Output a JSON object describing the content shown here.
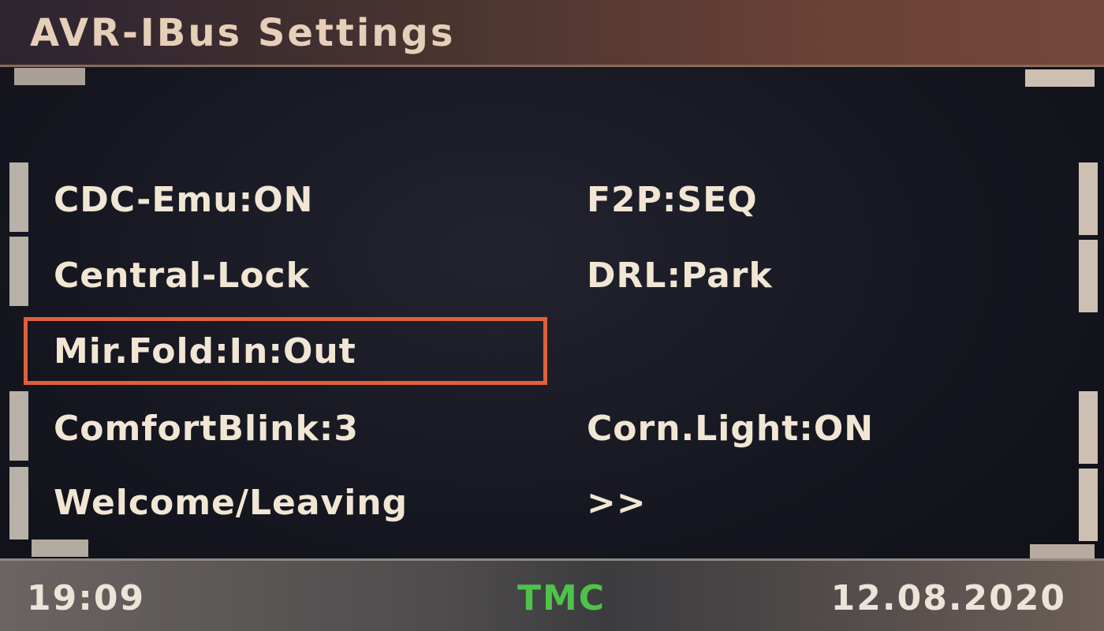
{
  "header": {
    "title": "AVR-IBus Settings"
  },
  "menu": {
    "left": [
      {
        "label": "CDC-Emu:ON"
      },
      {
        "label": "Central-Lock"
      },
      {
        "label": "Mir.Fold:In:Out"
      },
      {
        "label": "ComfortBlink:3"
      },
      {
        "label": "Welcome/Leaving"
      }
    ],
    "right": [
      {
        "label": "F2P:SEQ"
      },
      {
        "label": "DRL:Park"
      },
      {
        "label": ""
      },
      {
        "label": "Corn.Light:ON"
      },
      {
        "label": ">>"
      }
    ],
    "selected": "Mir.Fold:In:Out"
  },
  "status": {
    "time": "19:09",
    "tmc": "TMC",
    "date": "12.08.2020"
  },
  "colors": {
    "highlight": "#e0603a",
    "tmc": "#4ec34a",
    "text": "#f1e6d4"
  }
}
